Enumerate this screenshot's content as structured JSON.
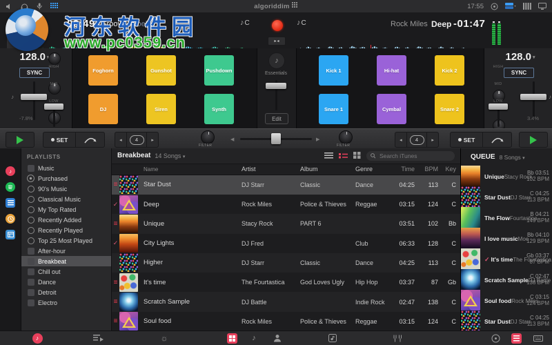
{
  "watermark": {
    "site_name": "河东软件园",
    "site_url": "www.pc0359.cn"
  },
  "menubar": {
    "brand": "algoriddim",
    "clock": "17:55"
  },
  "decks": {
    "left": {
      "elapsed": "00:49",
      "title": "Groove",
      "artist": "Joel",
      "key": "C",
      "bpm": "128.0",
      "sync_label": "SYNC",
      "tempo": "-7.8%"
    },
    "right": {
      "remaining": "-01:47",
      "artist": "Rock Miles",
      "title": "Deep",
      "key": "C",
      "bpm": "128.0",
      "sync_label": "SYNC",
      "tempo": "3.4%"
    }
  },
  "eq": {
    "high": "HIGH",
    "mid": "MID",
    "low": "LOW"
  },
  "fx": {
    "bank": "Essentials",
    "edit_label": "Edit"
  },
  "pads_left": [
    {
      "label": "Foghorn",
      "color": "#f09c2e"
    },
    {
      "label": "Gunshot",
      "color": "#edc522"
    },
    {
      "label": "Pushdown",
      "color": "#3ec98f"
    },
    {
      "label": "DJ",
      "color": "#f09c2e"
    },
    {
      "label": "Siren",
      "color": "#edc522"
    },
    {
      "label": "Synth",
      "color": "#3ec98f"
    }
  ],
  "pads_right": [
    {
      "label": "Kick 1",
      "color": "#2ba6f2"
    },
    {
      "label": "Hi-hat",
      "color": "#9a62d8"
    },
    {
      "label": "Kick 2",
      "color": "#eec31d"
    },
    {
      "label": "Snare 1",
      "color": "#2ba6f2"
    },
    {
      "label": "Cymbal",
      "color": "#9a62d8"
    },
    {
      "label": "Snare 2",
      "color": "#eec31d"
    }
  ],
  "transport": {
    "set_label": "SET",
    "loop_beats": "4",
    "filter_label": "FILTER"
  },
  "sidebar": {
    "header": "PLAYLISTS",
    "items": [
      {
        "label": "Music",
        "icon": "ic-note",
        "state": ""
      },
      {
        "label": "Purchased",
        "icon": "ic-store",
        "state": ""
      },
      {
        "label": "90's Music",
        "icon": "ic-smart",
        "state": ""
      },
      {
        "label": "Classical Music",
        "icon": "ic-smart",
        "state": ""
      },
      {
        "label": "My Top Rated",
        "icon": "ic-smart",
        "state": ""
      },
      {
        "label": "Recently Added",
        "icon": "ic-smart",
        "state": ""
      },
      {
        "label": "Recently Played",
        "icon": "ic-smart",
        "state": ""
      },
      {
        "label": "Top 25 Most Played",
        "icon": "ic-smart",
        "state": ""
      },
      {
        "label": "After-hour",
        "icon": "ic-note",
        "state": ""
      },
      {
        "label": "Breakbeat",
        "icon": "ic-note",
        "state": "selected"
      },
      {
        "label": "Chill out",
        "icon": "ic-note",
        "state": ""
      },
      {
        "label": "Dance",
        "icon": "ic-note",
        "state": ""
      },
      {
        "label": "Detroit",
        "icon": "ic-note",
        "state": ""
      },
      {
        "label": "Electro",
        "icon": "ic-note",
        "state": ""
      }
    ]
  },
  "library": {
    "title": "Breakbeat",
    "count": "14 Songs",
    "search_placeholder": "Search iTunes",
    "columns": {
      "name": "Name",
      "artist": "Artist",
      "album": "Album",
      "genre": "Genre",
      "time": "Time",
      "bpm": "BPM",
      "key": "Key"
    },
    "songs": [
      {
        "state": "selected",
        "marker": "queued",
        "art": "confetti",
        "name": "Star Dust",
        "artist": "DJ Starr",
        "album": "Classic",
        "genre": "Dance",
        "time": "04:25",
        "bpm": "113",
        "key": "C"
      },
      {
        "state": "",
        "marker": "played",
        "art": "triangle",
        "name": "Deep",
        "artist": "Rock Miles",
        "album": "Police & Thieves",
        "genre": "Reggae",
        "time": "03:15",
        "bpm": "124",
        "key": "C"
      },
      {
        "state": "",
        "marker": "queued",
        "art": "crowd",
        "name": "Unique",
        "artist": "Stacy Rock",
        "album": "PART 6",
        "genre": "",
        "time": "03:51",
        "bpm": "102",
        "key": "Bb"
      },
      {
        "state": "",
        "marker": "played",
        "art": "city",
        "name": "City Lights",
        "artist": "DJ Fred",
        "album": "",
        "genre": "Club",
        "time": "06:33",
        "bpm": "128",
        "key": "C"
      },
      {
        "state": "",
        "marker": "",
        "art": "confetti",
        "name": "Higher",
        "artist": "DJ Starr",
        "album": "Classic",
        "genre": "Dance",
        "time": "04:25",
        "bpm": "113",
        "key": "C"
      },
      {
        "state": "",
        "marker": "queued",
        "art": "blobs",
        "name": "It's time",
        "artist": "The Fourtastica",
        "album": "God Loves Ugly",
        "genre": "Hip Hop",
        "time": "03:37",
        "bpm": "87",
        "key": "Gb"
      },
      {
        "state": "",
        "marker": "queued",
        "art": "sphere",
        "name": "Scratch Sample",
        "artist": "DJ Battle",
        "album": "",
        "genre": "Indie Rock",
        "time": "02:47",
        "bpm": "138",
        "key": "C"
      },
      {
        "state": "",
        "marker": "queued",
        "art": "triangle",
        "name": "Soul food",
        "artist": "Rock Miles",
        "album": "Police & Thieves",
        "genre": "Reggae",
        "time": "03:15",
        "bpm": "124",
        "key": "C"
      }
    ]
  },
  "queue": {
    "title": "QUEUE",
    "count": "8 Songs",
    "items": [
      {
        "marker": "",
        "art": "crowd",
        "title": "Unique",
        "artist": "Stacy Rock",
        "key_time": "Bb 03:51",
        "bpm": "102 BPM"
      },
      {
        "marker": "",
        "art": "confetti",
        "title": "Star Dust",
        "artist": "DJ Starr",
        "key_time": "C 04:25",
        "bpm": "113 BPM"
      },
      {
        "marker": "",
        "art": "flow",
        "title": "The Flow",
        "artist": "Fourtastica",
        "key_time": "B 04:21",
        "bpm": "149 BPM"
      },
      {
        "marker": "",
        "art": "palms",
        "title": "I love music",
        "artist": "Moe",
        "key_time": "Bb 04:10",
        "bpm": "129 BPM"
      },
      {
        "marker": "played",
        "art": "blobs",
        "title": "It's time",
        "artist": "The Fourtastica",
        "key_time": "Gb 03:37",
        "bpm": "87 BPM"
      },
      {
        "marker": "",
        "art": "sphere",
        "title": "Scratch Sample",
        "artist": "DJ Battle",
        "key_time": "C 02:47",
        "bpm": "138 BPM"
      },
      {
        "marker": "",
        "art": "triangle",
        "title": "Soul food",
        "artist": "Rock Miles",
        "key_time": "C 03:15",
        "bpm": "124 BPM"
      },
      {
        "marker": "",
        "art": "confetti",
        "title": "Star Dust",
        "artist": "DJ Starr",
        "key_time": "C 04:25",
        "bpm": "113 BPM"
      }
    ]
  },
  "colors": {
    "accent_red": "#e8405c",
    "check_pink": "#d95673",
    "play_green": "#35c24b",
    "pad_blue": "#2ba6f2"
  }
}
